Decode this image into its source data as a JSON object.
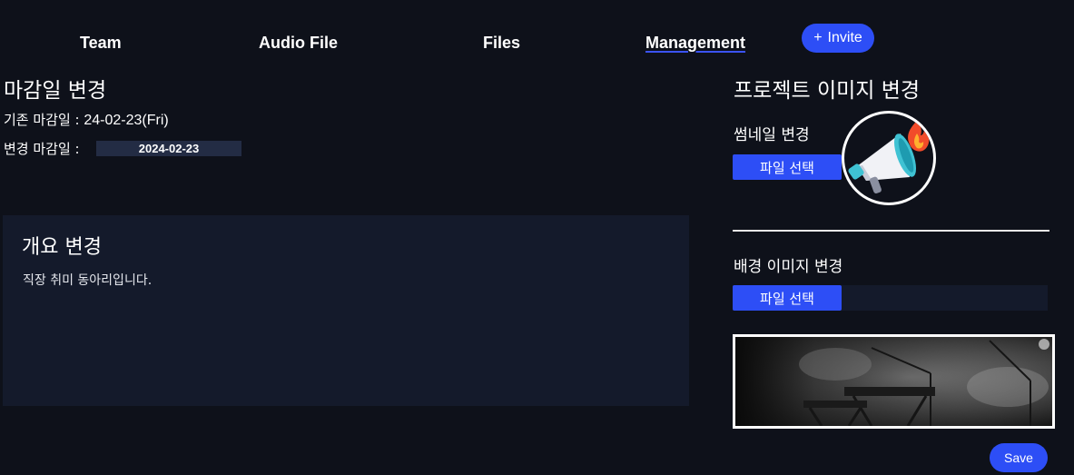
{
  "nav": {
    "items": [
      {
        "label": "Team"
      },
      {
        "label": "Audio File"
      },
      {
        "label": "Files"
      },
      {
        "label": "Management"
      }
    ],
    "invite_label": "Invite",
    "invite_icon": "+"
  },
  "deadline": {
    "title": "마감일 변경",
    "current_label": "기존 마감일 : ",
    "current_value": "24-02-23(Fri)",
    "new_label": "변경 마감일 : ",
    "new_value": "2024-02-23"
  },
  "overview": {
    "title": "개요 변경",
    "text": "직장 취미 동아리입니다."
  },
  "project_image": {
    "title": "프로젝트 이미지 변경",
    "thumbnail_label": "썸네일 변경",
    "thumbnail_button": "파일 선택",
    "thumbnail_icon": "megaphone-fire-icon",
    "background_label": "배경 이미지 변경",
    "background_button": "파일 선택"
  },
  "save_label": "Save",
  "colors": {
    "background": "#0e111a",
    "accent": "#2d4ef6",
    "panel": "#141a2b"
  }
}
